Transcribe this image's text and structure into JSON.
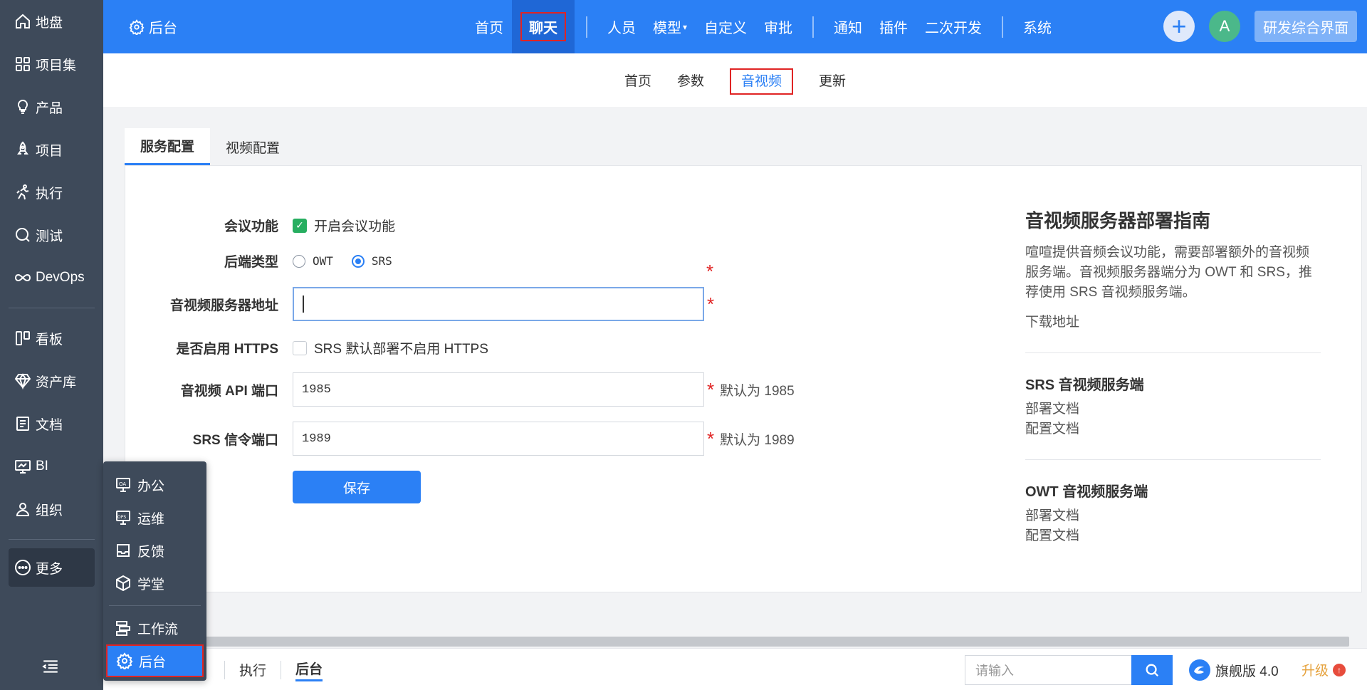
{
  "sidebar": {
    "items": [
      {
        "label": "地盘",
        "icon": "home-icon"
      },
      {
        "label": "项目集",
        "icon": "grid-icon"
      },
      {
        "label": "产品",
        "icon": "bulb-icon"
      },
      {
        "label": "项目",
        "icon": "rocket-icon"
      },
      {
        "label": "执行",
        "icon": "run-icon"
      },
      {
        "label": "测试",
        "icon": "search-circle-icon"
      },
      {
        "label": "DevOps",
        "icon": "infinity-icon"
      },
      {
        "label": "看板",
        "icon": "kanban-icon"
      },
      {
        "label": "资产库",
        "icon": "diamond-icon"
      },
      {
        "label": "文档",
        "icon": "doc-icon"
      },
      {
        "label": "BI",
        "icon": "monitor-icon"
      },
      {
        "label": "组织",
        "icon": "user-icon"
      },
      {
        "label": "更多",
        "icon": "more-icon"
      }
    ]
  },
  "topbar": {
    "title": "后台",
    "nav": [
      "首页",
      "聊天",
      "人员",
      "模型",
      "自定义",
      "审批",
      "通知",
      "插件",
      "二次开发",
      "系统"
    ],
    "active": "聊天",
    "avatar_letter": "A",
    "rd_button": "研发综合界面"
  },
  "subnav": {
    "items": [
      "首页",
      "参数",
      "音视频",
      "更新"
    ],
    "active": "音视频"
  },
  "tabs": {
    "service_config": "服务配置",
    "video_config": "视频配置"
  },
  "form": {
    "meeting": {
      "label": "会议功能",
      "option": "开启会议功能",
      "checked": true
    },
    "backend": {
      "label": "后端类型",
      "options": [
        "OWT",
        "SRS"
      ],
      "selected": "SRS"
    },
    "server_addr": {
      "label": "音视频服务器地址",
      "value": ""
    },
    "https": {
      "label": "是否启用 HTTPS",
      "option": "SRS 默认部署不启用 HTTPS",
      "checked": false
    },
    "api_port": {
      "label": "音视频 API 端口",
      "value": "1985",
      "hint": "默认为 1985"
    },
    "signal_port": {
      "label": "SRS 信令端口",
      "value": "1989",
      "hint": "默认为 1989"
    },
    "save": "保存"
  },
  "guide": {
    "title": "音视频服务器部署指南",
    "desc": "喧喧提供音频会议功能，需要部署额外的音视频服务端。音视频服务器端分为 OWT 和 SRS，推荐使用 SRS 音视频服务端。",
    "download": "下载地址",
    "srs": {
      "title": "SRS 音视频服务端",
      "deploy": "部署文档",
      "config": "配置文档"
    },
    "owt": {
      "title": "OWT 音视频服务端",
      "deploy": "部署文档",
      "config": "配置文档"
    }
  },
  "popup": {
    "items": [
      {
        "label": "办公",
        "icon": "oa-icon"
      },
      {
        "label": "运维",
        "icon": "ops-icon"
      },
      {
        "label": "反馈",
        "icon": "inbox-icon"
      },
      {
        "label": "学堂",
        "icon": "cube-icon"
      },
      {
        "label": "工作流",
        "icon": "workflow-icon"
      },
      {
        "label": "后台",
        "icon": "gear-icon"
      }
    ]
  },
  "bottombar": {
    "items": [
      "执行",
      "后台"
    ],
    "active": "后台",
    "search_placeholder": "请输入",
    "version": "旗舰版 4.0",
    "upgrade": "升级"
  },
  "colors": {
    "primary": "#2b80f5",
    "sidebar": "#3e4a5a",
    "highlight_border": "#e02424",
    "success": "#27ae60"
  }
}
